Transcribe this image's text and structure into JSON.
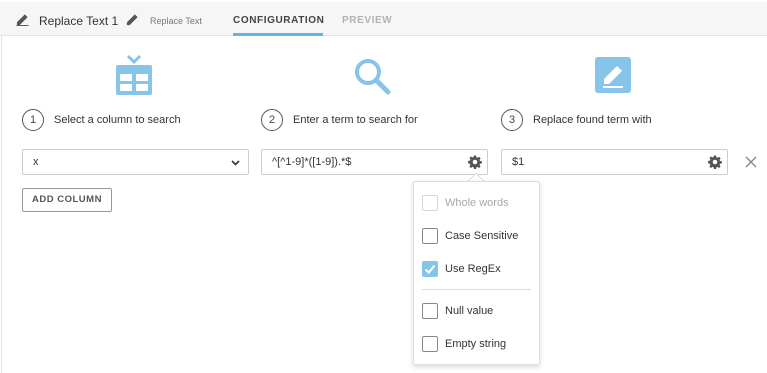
{
  "header": {
    "title": "Replace Text 1",
    "subtitle": "Replace Text",
    "tabs": [
      {
        "label": "CONFIGURATION",
        "active": true
      },
      {
        "label": "PREVIEW",
        "active": false
      }
    ]
  },
  "steps": [
    {
      "number": "1",
      "label": "Select a column to search",
      "icon": "table-icon"
    },
    {
      "number": "2",
      "label": "Enter a term to search for",
      "icon": "search-icon"
    },
    {
      "number": "3",
      "label": "Replace found term with",
      "icon": "edit-icon"
    }
  ],
  "fields": {
    "column": "x",
    "search_term": "^[^1-9]*([1-9]).*$",
    "replacement": "$1"
  },
  "add_column_label": "ADD COLUMN",
  "options": {
    "whole_words": {
      "label": "Whole words",
      "checked": false,
      "disabled": true
    },
    "case_sensitive": {
      "label": "Case Sensitive",
      "checked": false
    },
    "use_regex": {
      "label": "Use RegEx",
      "checked": true
    },
    "null_value": {
      "label": "Null value",
      "checked": false
    },
    "empty_string": {
      "label": "Empty string",
      "checked": false
    }
  },
  "colors": {
    "accent": "#5fb4e0",
    "icon": "#86c4ea",
    "checkbox_checked": "#86c4ea"
  }
}
